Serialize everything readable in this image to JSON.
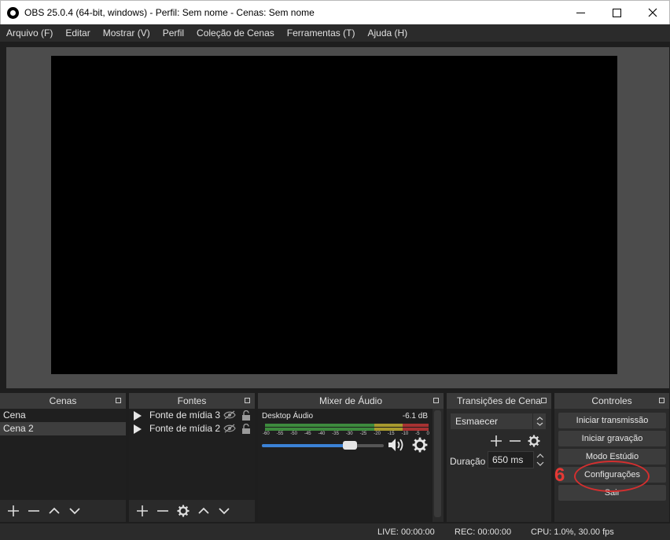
{
  "window": {
    "title": "OBS 25.0.4 (64-bit, windows) - Perfil: Sem nome - Cenas: Sem nome",
    "minimize_icon": "minimize-icon",
    "maximize_icon": "maximize-icon",
    "close_icon": "close-icon"
  },
  "menu": {
    "items": [
      "Arquivo (F)",
      "Editar",
      "Mostrar (V)",
      "Perfil",
      "Coleção de Cenas",
      "Ferramentas (T)",
      "Ajuda (H)"
    ]
  },
  "scenes": {
    "title": "Cenas",
    "items": [
      "Cena",
      "Cena 2"
    ]
  },
  "sources": {
    "title": "Fontes",
    "items": [
      "Fonte de mídia 3",
      "Fonte de mídia 2"
    ]
  },
  "mixer": {
    "title": "Mixer de Áudio",
    "channel_name": "Desktop Áudio",
    "level": "-6.1 dB",
    "ticks": [
      "-60",
      "-55",
      "-50",
      "-45",
      "-40",
      "-35",
      "-30",
      "-25",
      "-20",
      "-15",
      "-10",
      "-5",
      "0"
    ],
    "volume_fraction": 0.72
  },
  "transitions": {
    "title": "Transições de Cena",
    "selected": "Esmaecer",
    "duration_label": "Duração",
    "duration_value": "650 ms"
  },
  "controls": {
    "title": "Controles",
    "buttons": [
      "Iniciar transmissão",
      "Iniciar gravação",
      "Modo Estúdio",
      "Configurações",
      "Sair"
    ]
  },
  "annotation": {
    "number": "6",
    "color": "#d32f2f"
  },
  "status": {
    "live": "LIVE: 00:00:00",
    "rec": "REC: 00:00:00",
    "cpu": "CPU: 1.0%, 30.00 fps"
  },
  "colors": {
    "accent_blue": "#3b82d6",
    "meter_green": "#3d8b3d",
    "meter_yellow": "#a89a2e",
    "meter_red": "#a83232"
  }
}
